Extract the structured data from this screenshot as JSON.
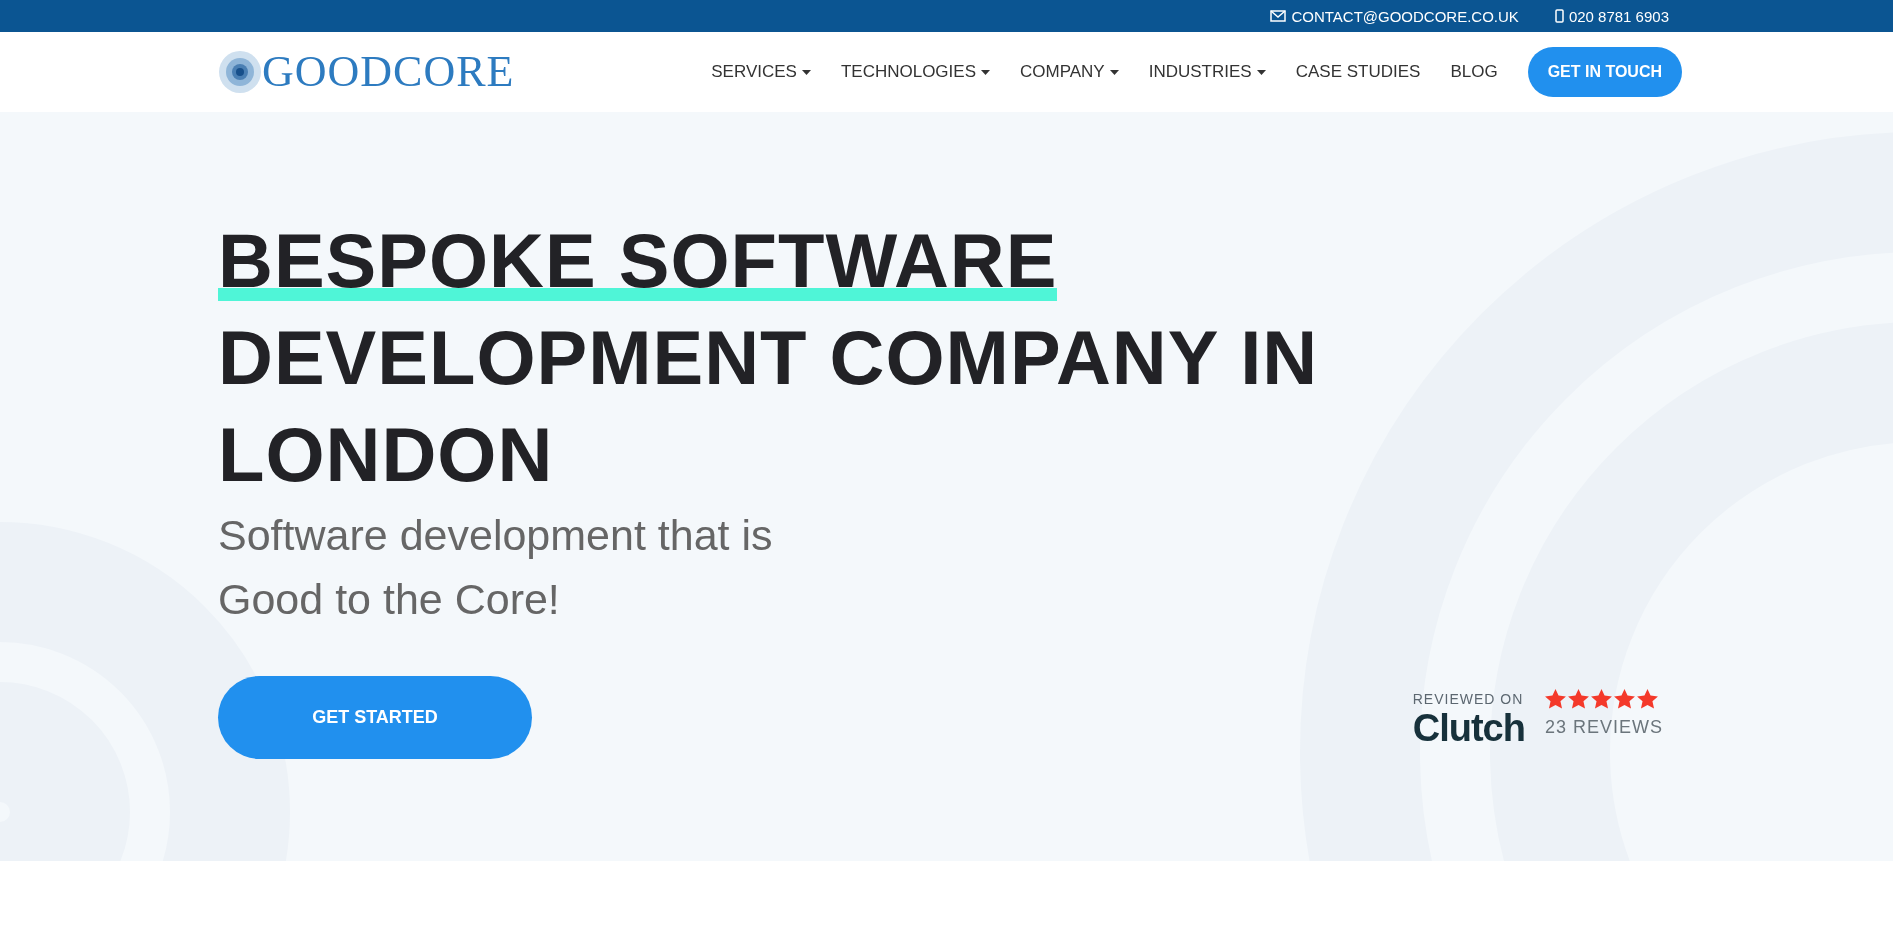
{
  "top_bar": {
    "email": "CONTACT@GOODCORE.CO.UK",
    "phone": "020 8781 6903"
  },
  "header": {
    "logo": "GOODCORE",
    "nav": [
      {
        "label": "SERVICES",
        "dropdown": true
      },
      {
        "label": "TECHNOLOGIES",
        "dropdown": true
      },
      {
        "label": "COMPANY",
        "dropdown": true
      },
      {
        "label": "INDUSTRIES",
        "dropdown": true
      },
      {
        "label": "CASE STUDIES",
        "dropdown": false
      },
      {
        "label": "BLOG",
        "dropdown": false
      }
    ],
    "cta": "GET IN TOUCH"
  },
  "hero": {
    "title_highlight": "BESPOKE SOFTWARE",
    "title_rest": "DEVELOPMENT COMPANY IN LONDON",
    "subtitle": [
      "Software development that is",
      "Good to the Core!"
    ],
    "button": "GET STARTED",
    "review": {
      "caption": "REVIEWED ON",
      "brand": "Clutch",
      "stars": 5,
      "count": "23 REVIEWS"
    }
  }
}
